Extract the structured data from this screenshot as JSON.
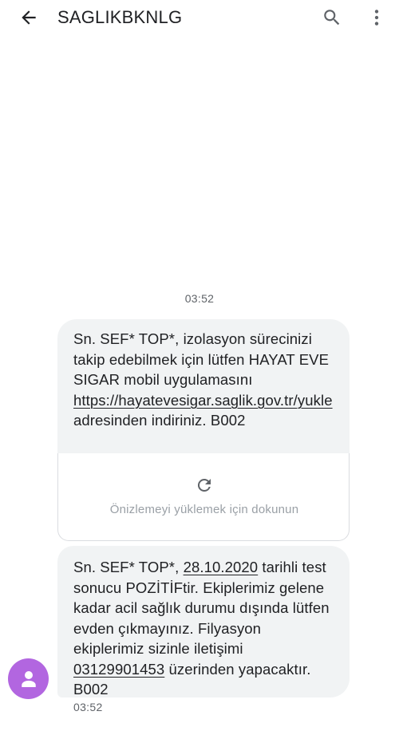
{
  "header": {
    "title": "SAGLIKBKNLG",
    "back_icon": "arrow-back-icon",
    "search_icon": "search-icon",
    "more_icon": "more-vert-icon"
  },
  "conversation": {
    "timestamp_separator": "03:52",
    "message1": {
      "line_a": "Sn. SEF* TOP*, izolasyon sürecinizi takip edebilmek için lütfen HAYAT EVE SIGAR mobil uygulamasını ",
      "link": "https://hayatevesigar.saglik.gov.tr/yukle",
      "line_b": " adresinden indiriniz. B002"
    },
    "preview": {
      "icon": "refresh-icon",
      "label": "Önizlemeyi yüklemek için dokunun"
    },
    "message2": {
      "part_a": "Sn. SEF* TOP*, ",
      "date_link": "28.10.2020",
      "part_b": " tarihli test sonucu POZİTİFtir. Ekiplerimiz gelene kadar acil sağlık durumu dışında lütfen evden çıkmayınız. Filyasyon ekiplerimiz sizinle iletişimi ",
      "phone_link": "03129901453",
      "part_c": " üzerinden yapacaktır. B002"
    },
    "sender_avatar_icon": "person-icon",
    "avatar_color": "#b266e0",
    "last_timestamp": "03:52"
  }
}
